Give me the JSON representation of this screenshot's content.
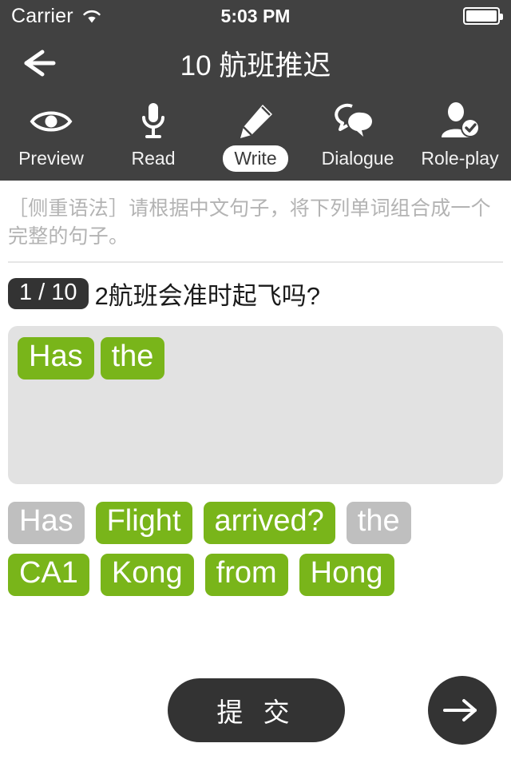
{
  "status_bar": {
    "carrier": "Carrier",
    "wifi_icon": "wifi-icon",
    "time": "5:03 PM",
    "battery_icon": "battery-icon"
  },
  "nav": {
    "back_icon": "back-arrow-icon",
    "title": "10 航班推迟"
  },
  "tabs": [
    {
      "id": "preview",
      "label": "Preview",
      "icon": "eye-icon",
      "active": false
    },
    {
      "id": "read",
      "label": "Read",
      "icon": "microphone-icon",
      "active": false
    },
    {
      "id": "write",
      "label": "Write",
      "icon": "pencil-icon",
      "active": true
    },
    {
      "id": "dialogue",
      "label": "Dialogue",
      "icon": "speech-bubbles-icon",
      "active": false
    },
    {
      "id": "roleplay",
      "label": "Role-play",
      "icon": "person-check-icon",
      "active": false
    }
  ],
  "instruction": "［侧重语法］请根据中文句子，将下列单词组合成一个完整的句子。",
  "question": {
    "badge": "1 / 10",
    "prompt": "2航班会准时起飞吗?"
  },
  "answer_area": {
    "placed_words": [
      {
        "text": "Has",
        "state": "placed"
      },
      {
        "text": "the",
        "state": "placed"
      }
    ]
  },
  "word_bank": {
    "words": [
      {
        "text": "Has",
        "state": "used"
      },
      {
        "text": "Flight",
        "state": "available"
      },
      {
        "text": "arrived?",
        "state": "available"
      },
      {
        "text": "the",
        "state": "used"
      },
      {
        "text": "CA1",
        "state": "available"
      },
      {
        "text": "Kong",
        "state": "available"
      },
      {
        "text": "from",
        "state": "available"
      },
      {
        "text": "Hong",
        "state": "available"
      }
    ]
  },
  "footer": {
    "submit_label": "提 交",
    "next_icon": "arrow-right-icon"
  },
  "colors": {
    "chrome_dark": "#414141",
    "accent_green": "#79b51a",
    "used_gray": "#bfbfbf",
    "dropzone_bg": "#e2e2e2",
    "button_dark": "#333333",
    "instruction_text": "#b3b3b3"
  }
}
